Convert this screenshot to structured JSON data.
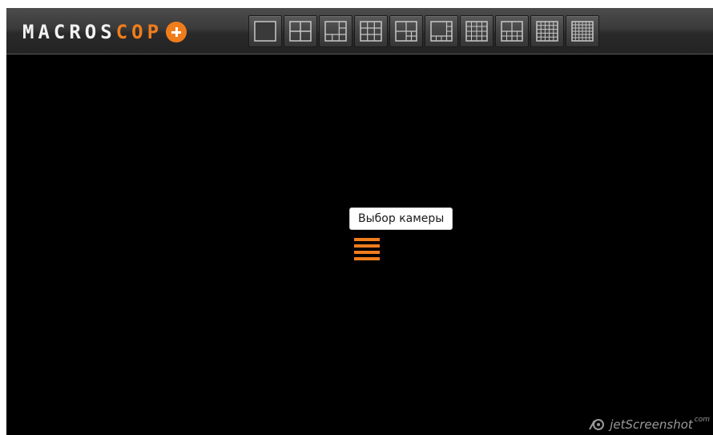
{
  "app": {
    "logo_text_light": "MACROS",
    "logo_text_accent": "COP",
    "logo_plus_icon": "plus-circle-icon",
    "accent_color": "#f07d1c"
  },
  "toolbar": {
    "layouts": [
      {
        "icon": "layout-1x1-icon"
      },
      {
        "icon": "layout-2x2-icon"
      },
      {
        "icon": "layout-1plus5-icon"
      },
      {
        "icon": "layout-3x3-icon"
      },
      {
        "icon": "layout-1plus7-icon"
      },
      {
        "icon": "layout-1plus12-icon"
      },
      {
        "icon": "layout-4x4-icon"
      },
      {
        "icon": "layout-2plus8-icon"
      },
      {
        "icon": "layout-5x5-icon"
      },
      {
        "icon": "layout-6x6-icon"
      }
    ]
  },
  "main": {
    "camera_select_icon": "menu-lines-icon",
    "tooltip": "Выбор камеры"
  },
  "watermark": {
    "text": "jetScreenshot",
    "superscript": "com"
  }
}
